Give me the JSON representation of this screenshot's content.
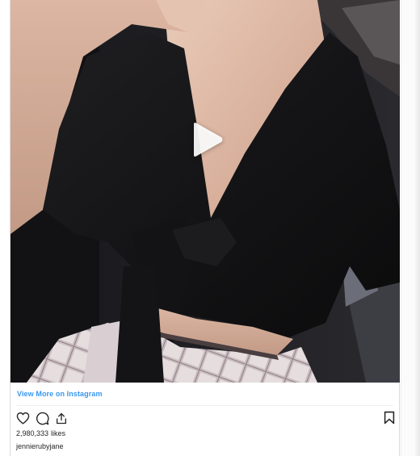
{
  "post": {
    "view_more_label": "View More on Instagram",
    "likes_count": "2,980,333",
    "likes_label": "likes",
    "username": "jennierubyjane"
  },
  "icons": {
    "play": "play-icon",
    "like": "heart-outline-icon",
    "comment": "comment-bubble-icon",
    "share": "share-upload-icon",
    "save": "bookmark-icon"
  },
  "colors": {
    "link": "#3897f0",
    "text": "#262626",
    "border": "#dbdbdb"
  }
}
